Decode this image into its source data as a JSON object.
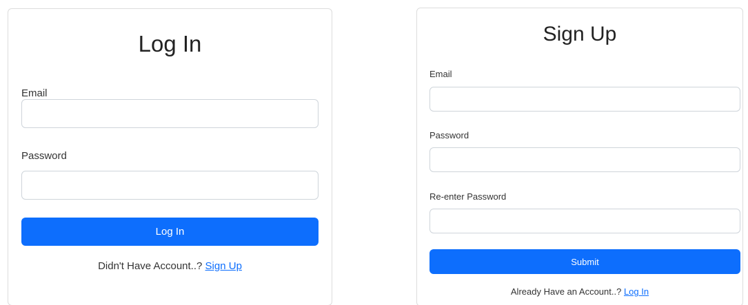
{
  "login": {
    "title": "Log In",
    "email_label": "Email",
    "email_value": "",
    "password_label": "Password",
    "password_value": "",
    "button_label": "Log In",
    "footer_text": "Didn't Have Account..?",
    "footer_link": "Sign Up"
  },
  "signup": {
    "title": "Sign Up",
    "email_label": "Email",
    "email_value": "",
    "password_label": "Password",
    "password_value": "",
    "reenter_label": "Re-enter Password",
    "reenter_value": "",
    "button_label": "Submit",
    "footer_text": "Already Have an Account..?",
    "footer_link": "Log In"
  },
  "colors": {
    "primary": "#0d6efd",
    "border": "#ced4da"
  }
}
